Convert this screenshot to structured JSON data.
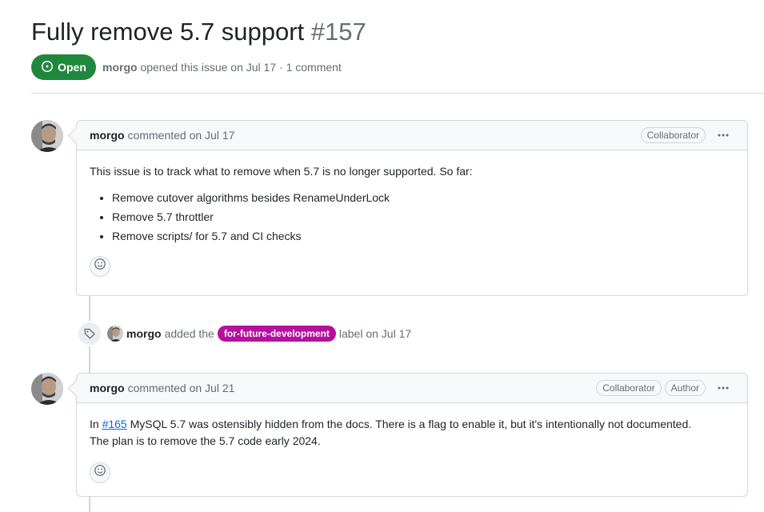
{
  "issue": {
    "title": "Fully remove 5.7 support",
    "number": "#157",
    "state": "Open",
    "author": "morgo",
    "meta_text": "opened this issue on Jul 17 · 1 comment"
  },
  "comments": [
    {
      "author": "morgo",
      "action": "commented on Jul 17",
      "badges": [
        "Collaborator"
      ],
      "body_intro": "This issue is to track what to remove when 5.7 is no longer supported. So far:",
      "list": [
        "Remove cutover algorithms besides RenameUnderLock",
        "Remove 5.7 throttler",
        "Remove scripts/ for 5.7 and CI checks"
      ]
    },
    {
      "author": "morgo",
      "action": "commented on Jul 21",
      "badges": [
        "Collaborator",
        "Author"
      ],
      "body_prefix": "In ",
      "link_text": "#165",
      "body_line1_rest": " MySQL 5.7 was ostensibly hidden from the docs. There is a flag to enable it, but it's intentionally not documented.",
      "body_line2": "The plan is to remove the 5.7 code early 2024."
    }
  ],
  "label_event": {
    "author": "morgo",
    "action_prefix": "added the",
    "label": "for-future-development",
    "label_color": "#b60f9f",
    "action_suffix": "label on Jul 17"
  },
  "colors": {
    "open_green": "#1f883d",
    "link_blue": "#0969da",
    "muted": "#656d76",
    "border": "#d0d7de"
  },
  "icons": {
    "state": "issue-opened-icon",
    "menu": "kebab-horizontal-icon",
    "reaction": "smiley-icon",
    "event": "tag-icon"
  }
}
